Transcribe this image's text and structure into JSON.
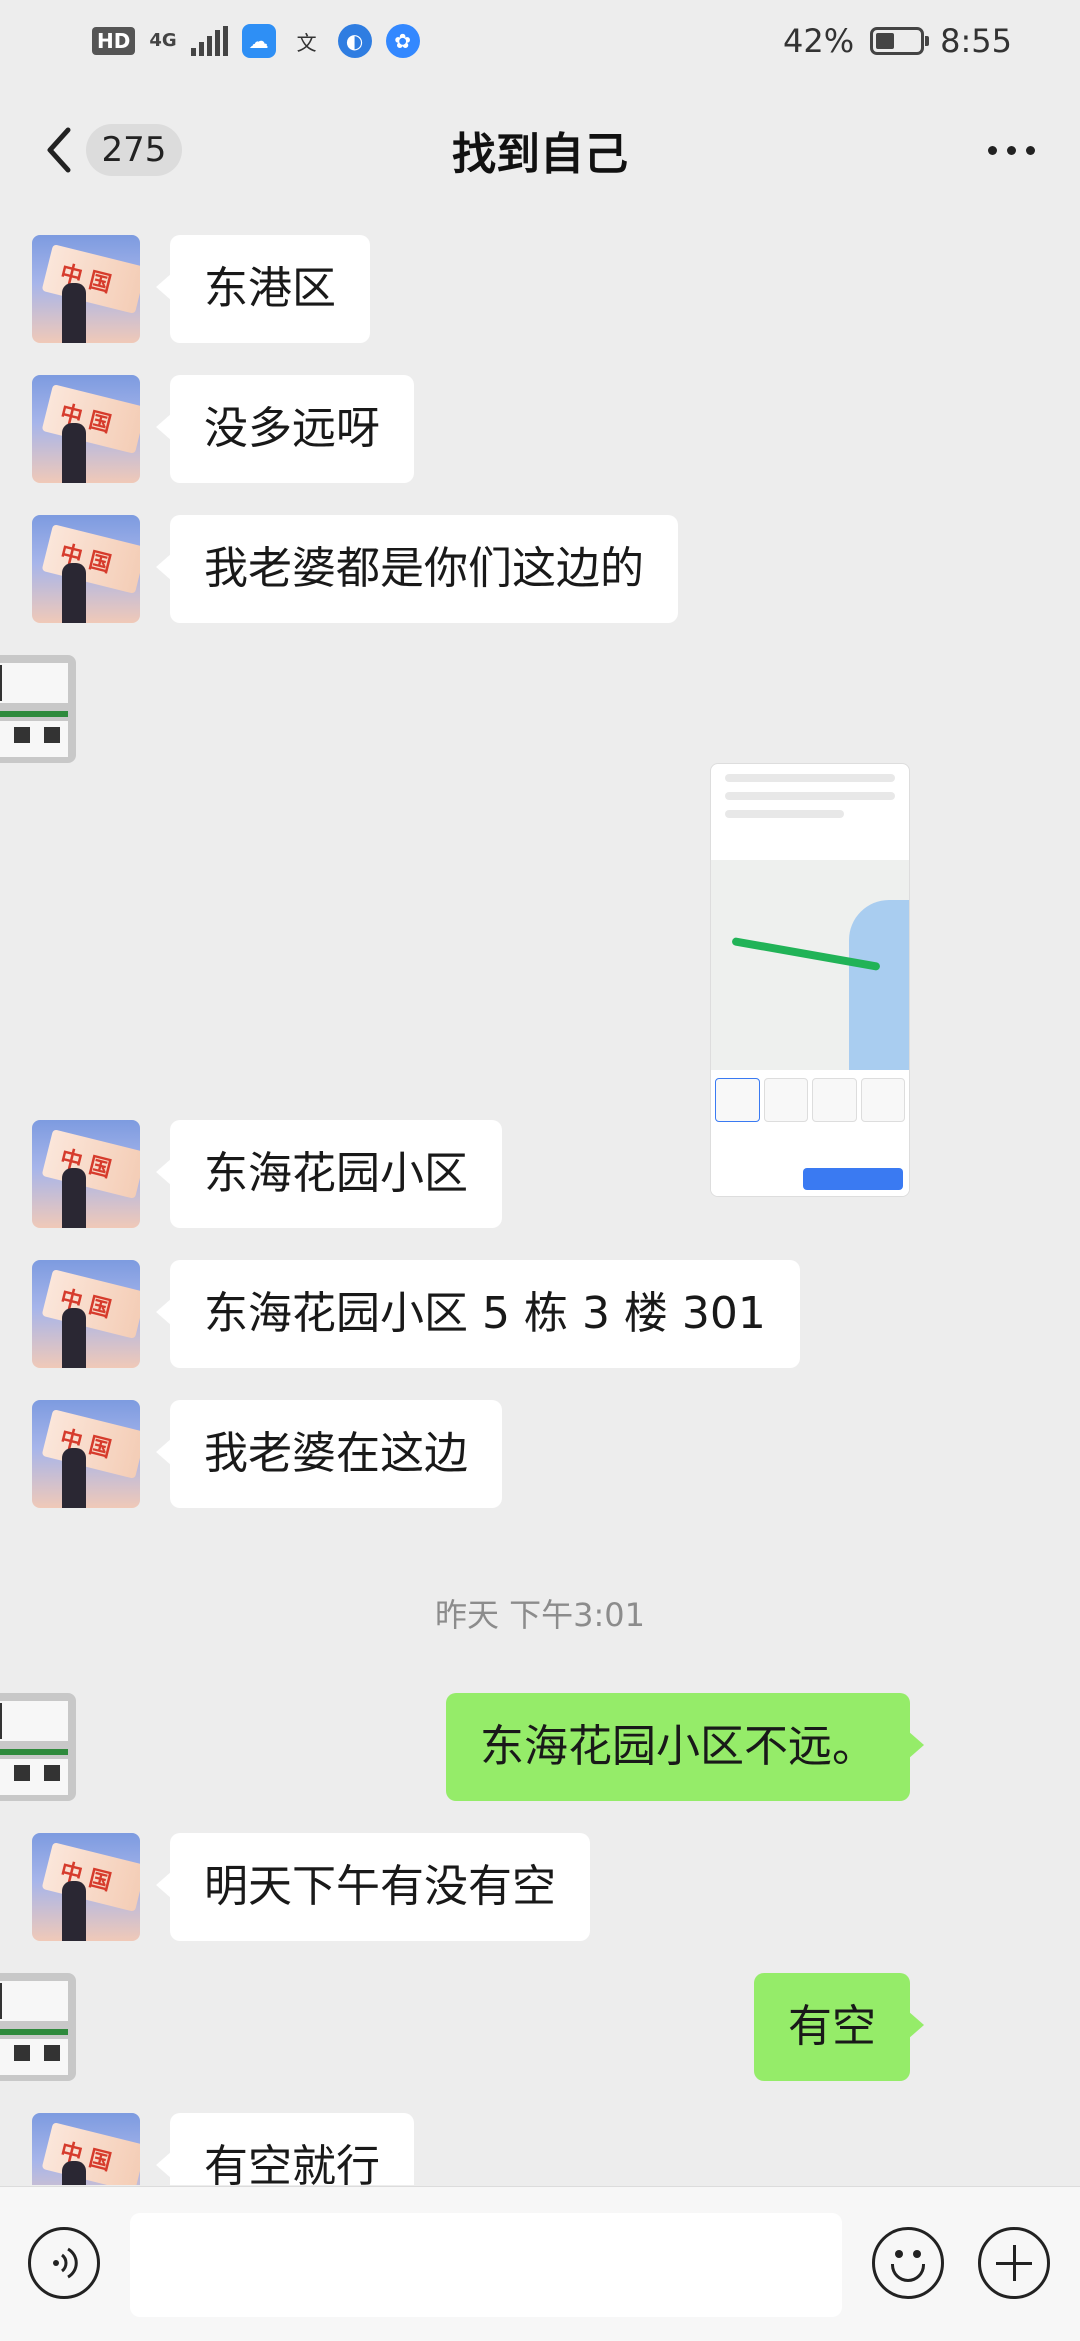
{
  "status_bar": {
    "hd_label": "HD",
    "network_label": "4G",
    "battery_text": "42%",
    "battery_level": 0.42,
    "time": "8:55"
  },
  "header": {
    "back_icon": "chevron-left-icon",
    "unread_count": "275",
    "title": "找到自己",
    "more_icon": "more-dots-icon"
  },
  "messages": [
    {
      "side": "left",
      "text": "东港区"
    },
    {
      "side": "left",
      "text": "没多远呀"
    },
    {
      "side": "left",
      "text": "我老婆都是你们这边的"
    },
    {
      "side": "right",
      "type": "image",
      "image_desc": "map-screenshot"
    },
    {
      "side": "left",
      "text": "东海花园小区"
    },
    {
      "side": "left",
      "text": "东海花园小区 5 栋 3 楼 301"
    },
    {
      "side": "left",
      "text": "我老婆在这边"
    },
    {
      "type": "timestamp",
      "text": "昨天 下午3:01"
    },
    {
      "side": "right",
      "text": "东海花园小区不远。"
    },
    {
      "side": "left",
      "text": "明天下午有没有空"
    },
    {
      "side": "right",
      "text": "有空"
    },
    {
      "side": "left",
      "text": "有空就行"
    }
  ],
  "input_bar": {
    "voice_icon": "voice-icon",
    "input_value": "",
    "emoji_icon": "emoji-icon",
    "plus_icon": "plus-icon"
  }
}
